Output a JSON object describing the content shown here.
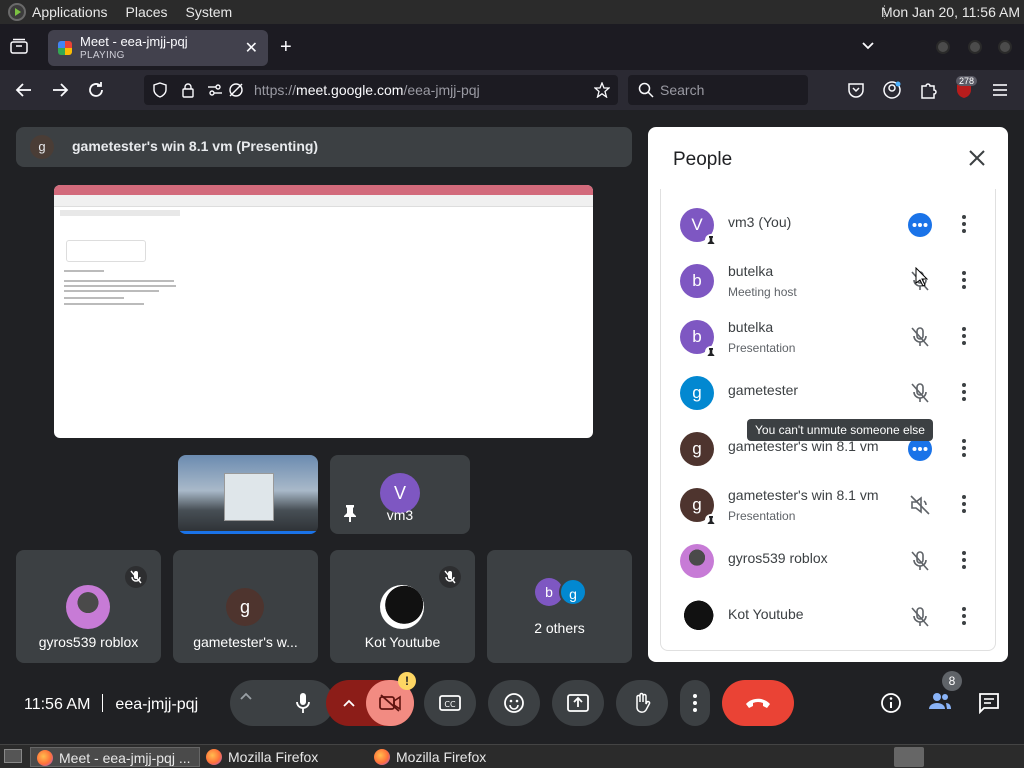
{
  "system_panel": {
    "menus": [
      "Applications",
      "Places",
      "System"
    ],
    "clock": "Mon Jan 20, 11:56 AM"
  },
  "browser": {
    "tab": {
      "title": "Meet - eea-jmjj-pqj",
      "subtitle": "PLAYING"
    },
    "url_prefix": "https://",
    "url_host": "meet.google.com",
    "url_path": "/eea-jmjj-pqj",
    "search_placeholder": "Search",
    "extension_badge": "278"
  },
  "meet": {
    "presenting_avatar": "g",
    "presenting_label": "gametester's win 8.1 vm (Presenting)",
    "tiles": [
      {
        "avatar": "V",
        "name": "vm3"
      },
      {
        "name": "gyros539 roblox"
      },
      {
        "avatar": "g",
        "name": "gametester's w..."
      },
      {
        "name": "Kot Youtube"
      },
      {
        "avatar_1": "b",
        "avatar_2": "g",
        "name": "2 others"
      }
    ],
    "time": "11:56 AM",
    "meeting_code": "eea-jmjj-pqj",
    "participants_count": "8",
    "warning_mark": "!"
  },
  "people_panel": {
    "title": "People",
    "tooltip": "You can't unmute someone else",
    "people": [
      {
        "avatar": "V",
        "name": "vm3 (You)",
        "role": "",
        "color": "#7e57c2"
      },
      {
        "avatar": "b",
        "name": "butelka",
        "role": "Meeting host",
        "color": "#7e57c2"
      },
      {
        "avatar": "b",
        "name": "butelka",
        "role": "Presentation",
        "color": "#7e57c2"
      },
      {
        "avatar": "g",
        "name": "gametester",
        "role": "",
        "color": "#0288d1"
      },
      {
        "avatar": "g",
        "name": "gametester's win 8.1 vm",
        "role": "",
        "color": "#4e342e"
      },
      {
        "avatar": "g",
        "name": "gametester's win 8.1 vm",
        "role": "Presentation",
        "color": "#4e342e"
      },
      {
        "avatar": "",
        "name": "gyros539 roblox",
        "role": "",
        "color": "#8d6e63"
      },
      {
        "avatar": "",
        "name": "Kot Youtube",
        "role": "",
        "color": "#000000"
      }
    ]
  },
  "taskbar": {
    "items": [
      "Meet - eea-jmjj-pqj ...",
      "Mozilla Firefox",
      "Mozilla Firefox"
    ]
  },
  "colors": {
    "accent_blue": "#1a73e8",
    "end_call_red": "#ea4335",
    "meet_bg": "#202124"
  }
}
